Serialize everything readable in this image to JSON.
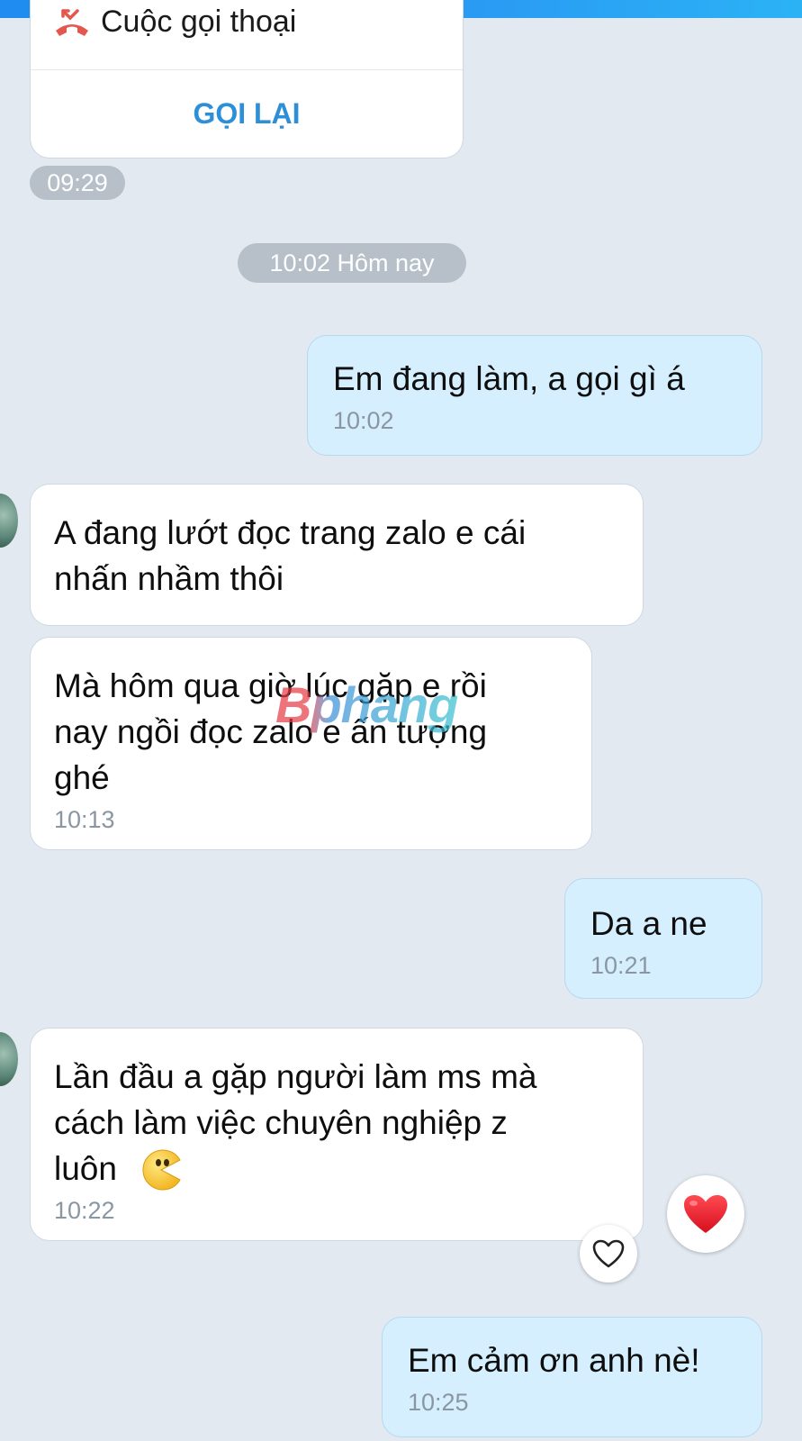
{
  "call_card": {
    "title": "Cuộc gọi thoại",
    "action_label": "GỌI LẠI",
    "time": "09:29"
  },
  "date_separator": "10:02 Hôm nay",
  "messages": [
    {
      "side": "out",
      "text": "Em đang làm, a gọi gì á",
      "time": "10:02"
    },
    {
      "side": "in",
      "text": "A đang lướt đọc trang zalo e cái\nnhấn nhầm thôi"
    },
    {
      "side": "in",
      "text": "Mà hôm qua giờ lúc gặp e rồi\nnay ngồi đọc zalo e ấn tượng\nghé",
      "time": "10:13"
    },
    {
      "side": "out",
      "text": "Da a ne",
      "time": "10:21"
    },
    {
      "side": "in",
      "text": "Lần đầu a gặp người làm ms mà\ncách làm việc chuyên nghiệp z\nluôn",
      "emoji": "pacman-emoji",
      "time": "10:22"
    },
    {
      "side": "out",
      "text": "Em cảm ơn anh nè!",
      "time": "10:25"
    }
  ],
  "reactions": {
    "heart_reaction": "heart-filled-red",
    "heart_outline": "heart-outline"
  },
  "watermark": "Bphang",
  "colors": {
    "top_bar": "#1e8cf0",
    "background": "#e2e9f1",
    "outgoing_bubble": "#d5efff",
    "incoming_bubble": "#ffffff",
    "call_action": "#2d8fd8",
    "call_icon": "#e4574f",
    "heart": "#e8212d"
  }
}
